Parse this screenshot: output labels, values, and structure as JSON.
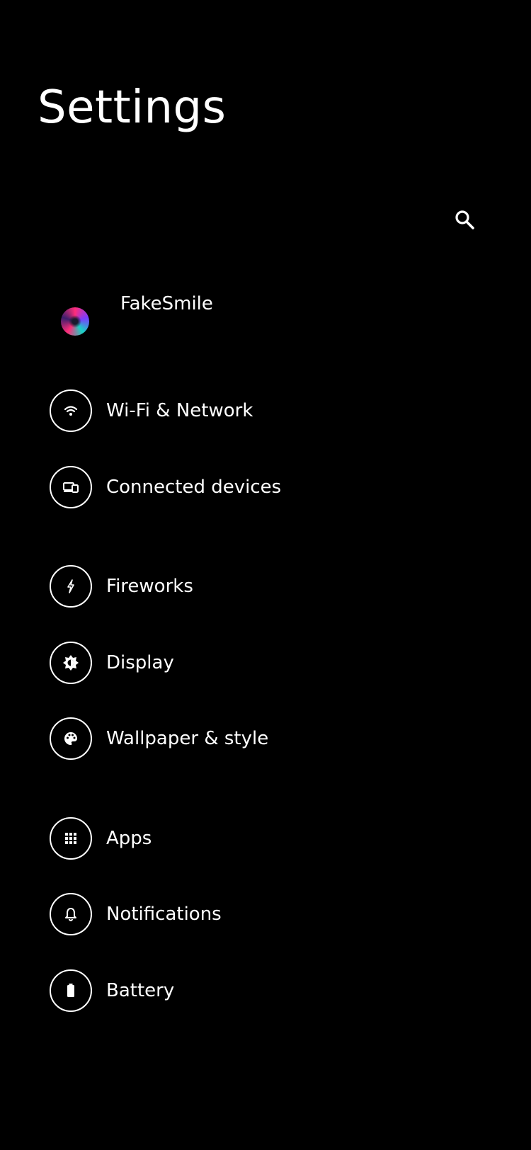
{
  "header": {
    "title": "Settings"
  },
  "search": {
    "icon": "search-icon"
  },
  "profile": {
    "name": "FakeSmile",
    "avatar": "avatar"
  },
  "items": [
    {
      "label": "Wi-Fi & Network",
      "icon": "wifi-icon"
    },
    {
      "label": "Connected devices",
      "icon": "connected-devices-icon"
    },
    {
      "label": "Fireworks",
      "icon": "fireworks-icon"
    },
    {
      "label": "Display",
      "icon": "display-icon"
    },
    {
      "label": "Wallpaper & style",
      "icon": "palette-icon"
    },
    {
      "label": "Apps",
      "icon": "apps-grid-icon"
    },
    {
      "label": "Notifications",
      "icon": "bell-icon"
    },
    {
      "label": "Battery",
      "icon": "battery-icon"
    }
  ],
  "colors": {
    "background": "#000000",
    "foreground": "#ffffff"
  }
}
